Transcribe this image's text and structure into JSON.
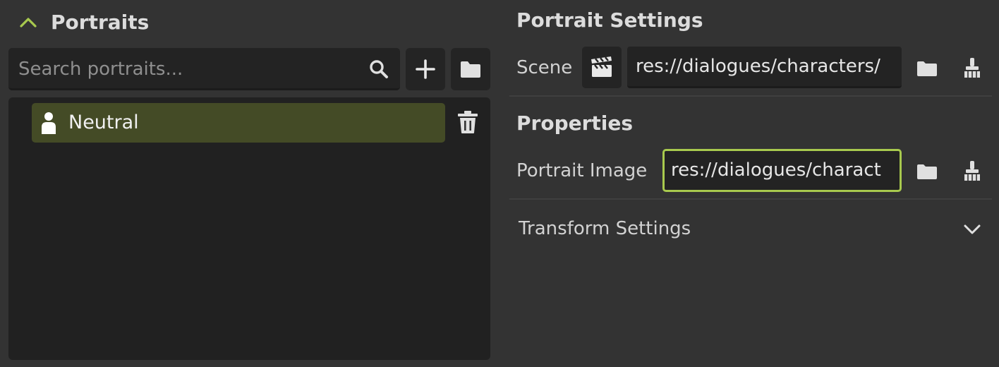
{
  "left_panel": {
    "section_title": "Portraits",
    "search": {
      "placeholder": "Search portraits...",
      "value": ""
    },
    "portraits": [
      {
        "label": "Neutral",
        "selected": true
      }
    ]
  },
  "right_panel": {
    "settings_heading": "Portrait Settings",
    "scene": {
      "label": "Scene",
      "value": "res://dialogues/characters/"
    },
    "properties_heading": "Properties",
    "portrait_image": {
      "label": "Portrait Image",
      "value": "res://dialogues/charact"
    },
    "transform_label": "Transform Settings"
  },
  "colors": {
    "background": "#333333",
    "panel": "#212121",
    "field": "#232323",
    "selected_row": "#444b26",
    "accent": "#a8c94e",
    "text": "#e0e0e0"
  },
  "icons": {
    "section_toggle": "chevron-up-icon",
    "search": "search-icon",
    "add": "plus-icon",
    "folder": "folder-icon",
    "portrait": "person-icon",
    "delete": "trash-icon",
    "scene": "clapperboard-icon",
    "clear": "brush-icon",
    "expand": "chevron-down-icon"
  }
}
